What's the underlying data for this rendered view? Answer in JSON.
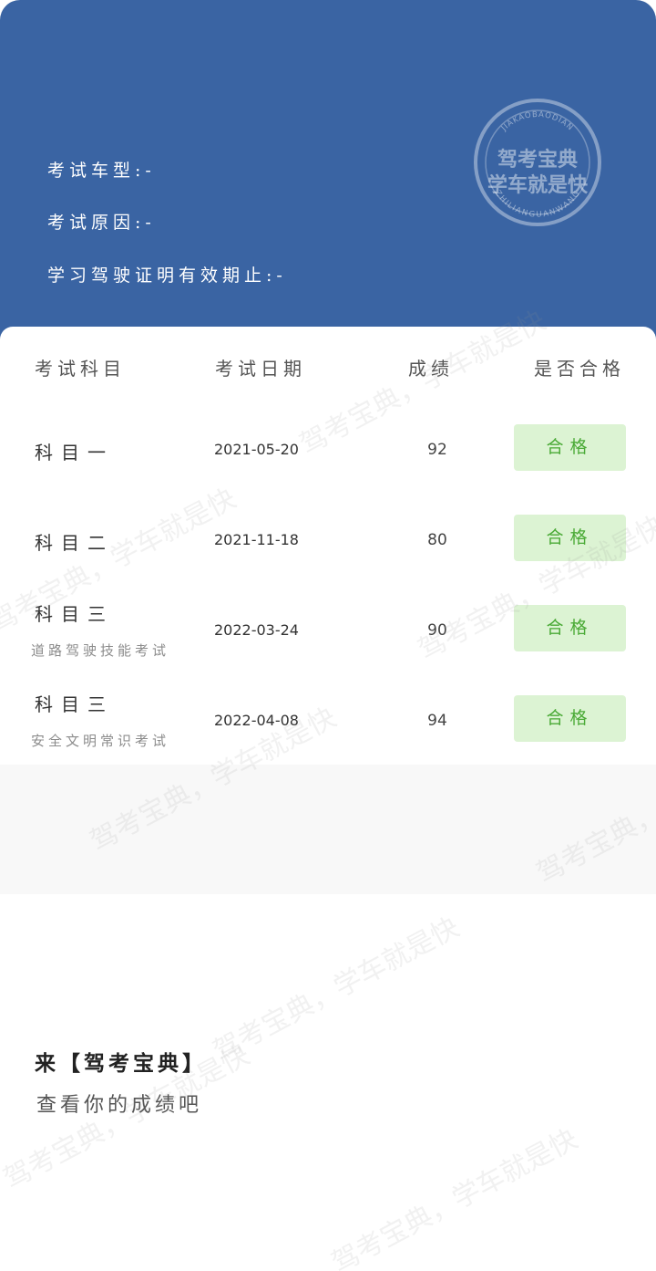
{
  "header": {
    "info": [
      {
        "label": "考试车型:",
        "value": "-"
      },
      {
        "label": "考试原因:",
        "value": "-"
      },
      {
        "label": "学习驾驶证明有效期止:",
        "value": "-"
      }
    ],
    "stamp": {
      "top_text": "JIAKAOBAODIAN",
      "line1": "驾考宝典",
      "line2": "学车就是快",
      "bottom_text": "ZHILIANGUANWANG"
    }
  },
  "table": {
    "headers": {
      "subject": "考试科目",
      "date": "考试日期",
      "score": "成绩",
      "pass": "是否合格"
    },
    "rows": [
      {
        "subject": "科目一",
        "subtitle": "",
        "date": "2021-05-20",
        "score": "92",
        "status": "合格"
      },
      {
        "subject": "科目二",
        "subtitle": "",
        "date": "2021-11-18",
        "score": "80",
        "status": "合格"
      },
      {
        "subject": "科目三",
        "subtitle": "道路驾驶技能考试",
        "date": "2022-03-24",
        "score": "90",
        "status": "合格"
      },
      {
        "subject": "科目三",
        "subtitle": "安全文明常识考试",
        "date": "2022-04-08",
        "score": "94",
        "status": "合格"
      }
    ]
  },
  "promo": {
    "title": "来【驾考宝典】",
    "subtitle": "查看你的成绩吧"
  },
  "watermark": {
    "text": "驾考宝典，学车就是快"
  },
  "colors": {
    "header_bg": "#3a64a3",
    "pass_bg": "#dcf3d3",
    "pass_text": "#4aaa36"
  }
}
